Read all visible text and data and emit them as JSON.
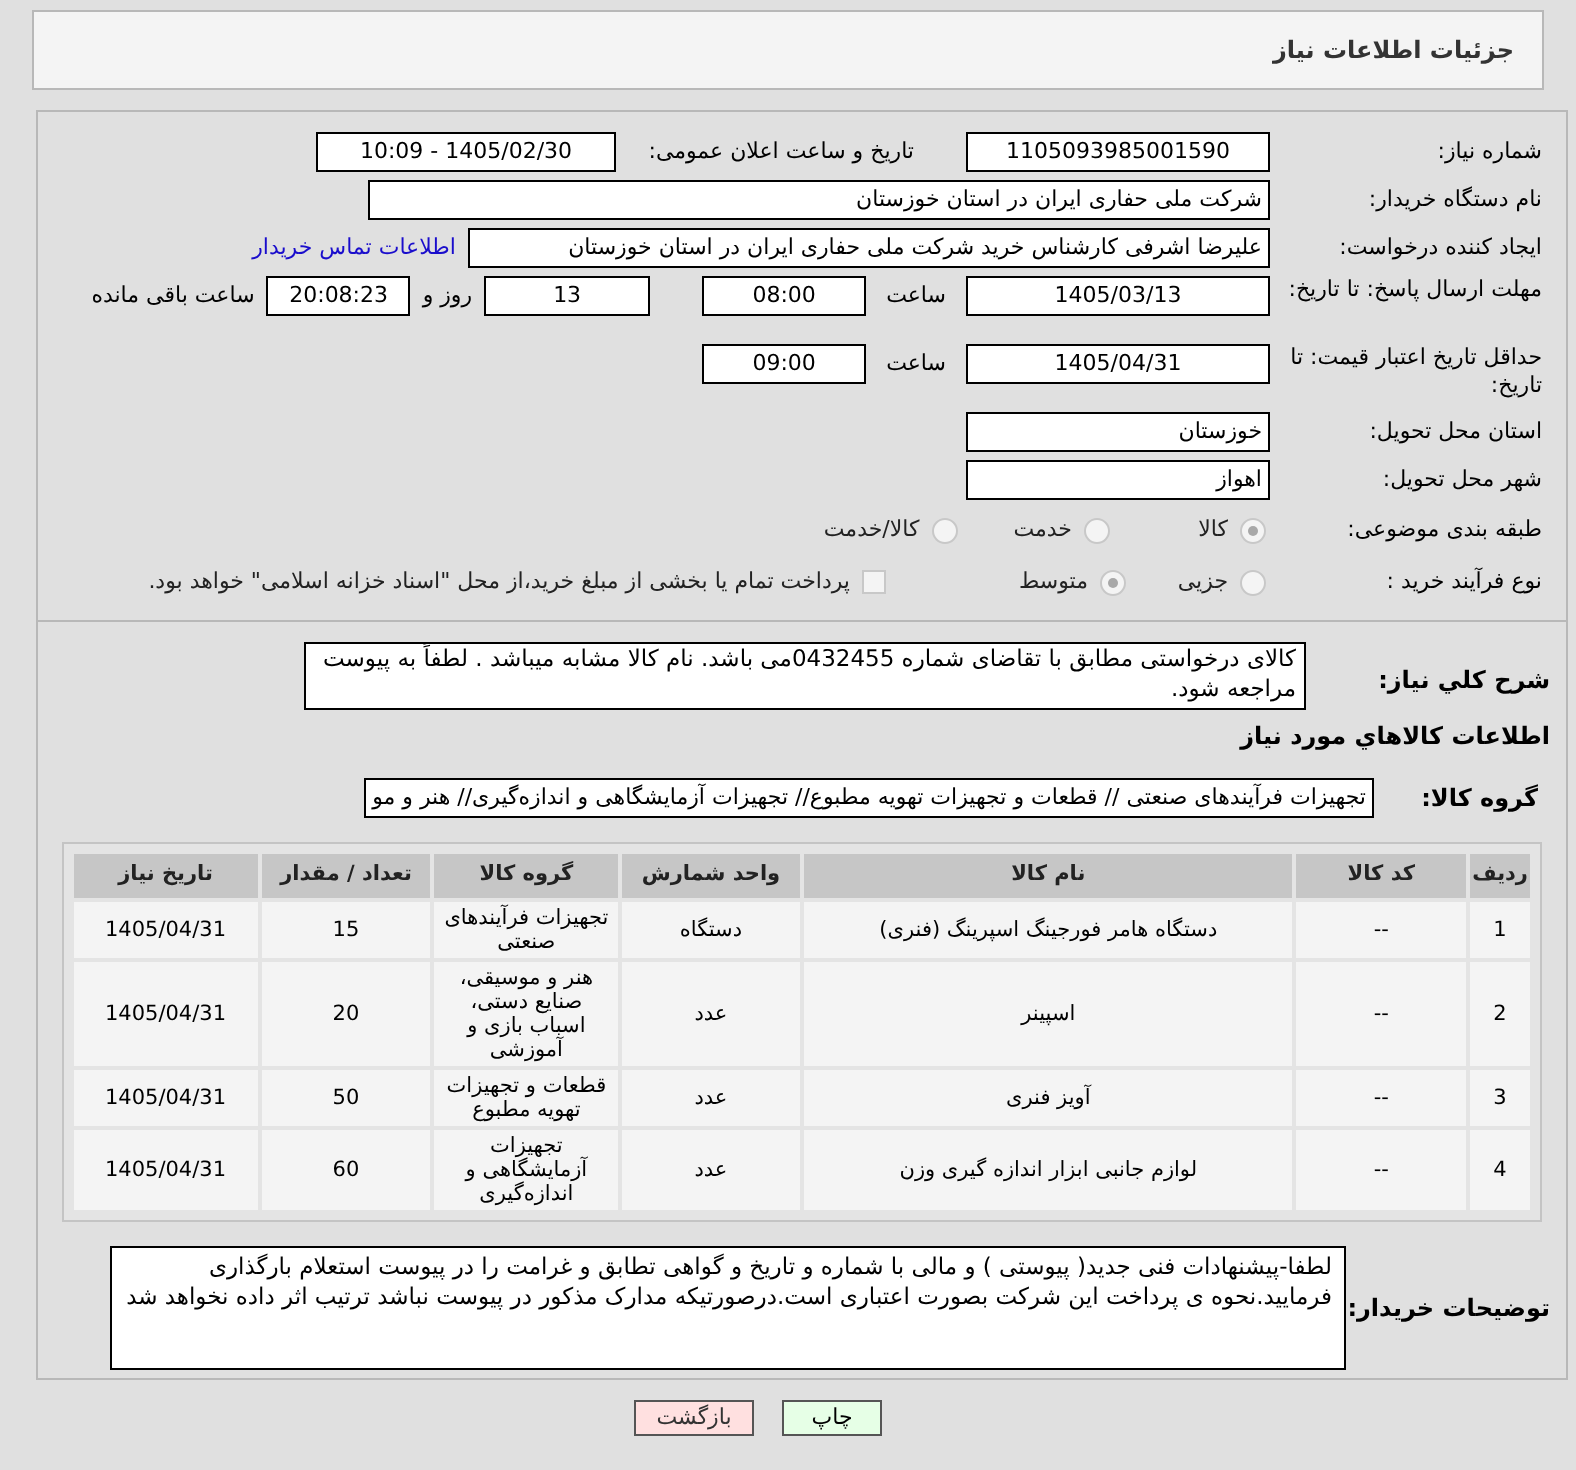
{
  "header": {
    "title": "جزئیات اطلاعات نیاز"
  },
  "need_number": {
    "label": "شماره نیاز:",
    "value": "1105093985001590"
  },
  "announce": {
    "label": "تاریخ و ساعت اعلان عمومی:",
    "value": "1405/02/30 - 10:09"
  },
  "buyer_org": {
    "label": "نام دستگاه خریدار:",
    "value": "شرکت ملی حفاری ایران در استان خوزستان"
  },
  "requester": {
    "label": "ایجاد کننده درخواست:",
    "value": "علیرضا اشرفی کارشناس خرید شرکت ملی حفاری ایران در استان خوزستان",
    "link": "اطلاعات تماس خریدار"
  },
  "deadline": {
    "label": "مهلت ارسال پاسخ: تا تاریخ:",
    "date": "1405/03/13",
    "time_label": "ساعت",
    "time": "08:00",
    "days": "13",
    "days_label": "روز و",
    "remaining": "20:08:23",
    "remaining_label": "ساعت باقی مانده"
  },
  "price_validity": {
    "label": "حداقل تاریخ اعتبار قیمت: تا تاریخ:",
    "date": "1405/04/31",
    "time_label": "ساعت",
    "time": "09:00"
  },
  "province": {
    "label": "استان محل تحویل:",
    "value": "خوزستان"
  },
  "city": {
    "label": "شهر محل تحویل:",
    "value": "اهواز"
  },
  "category": {
    "label": "طبقه بندی موضوعی:",
    "options": [
      {
        "label": "کالا",
        "selected": true
      },
      {
        "label": "خدمت",
        "selected": false
      },
      {
        "label": "کالا/خدمت",
        "selected": false
      }
    ]
  },
  "process": {
    "label": "نوع فرآیند خرید :",
    "options": [
      {
        "label": "جزیی",
        "selected": false
      },
      {
        "label": "متوسط",
        "selected": true
      }
    ],
    "treasury": {
      "label": "پرداخت تمام یا بخشی از مبلغ خرید،از محل \"اسناد خزانه اسلامی\" خواهد بود.",
      "checked": false
    }
  },
  "description": {
    "label": "شرح کلي نياز:",
    "value": "کالای درخواستی مطابق با تقاضای شماره 0432455می باشد. نام کالا مشابه میباشد . لطفاً به پیوست مراجعه شود."
  },
  "goods_section": {
    "title": "اطلاعات کالاهاي مورد نياز"
  },
  "goods_group": {
    "label": "گروه کالا:",
    "value": "تجهیزات فرآیندهای صنعتی //  قطعات و تجهیزات تهویه مطبوع// تجهیزات آزمایشگاهی و اندازه‌گیری// هنر و مو"
  },
  "table": {
    "columns": [
      "ردیف",
      "کد کالا",
      "نام کالا",
      "واحد شمارش",
      "گروه کالا",
      "تعداد / مقدار",
      "تاریخ نیاز"
    ],
    "rows": [
      [
        "1",
        "--",
        "دستگاه هامر فورجینگ اسپرینگ (فنری)",
        "دستگاه",
        "تجهیزات فرآیندهای صنعتی",
        "15",
        "1405/04/31"
      ],
      [
        "2",
        "--",
        "اسپینر",
        "عدد",
        "هنر و موسیقی، صنایع دستی، اسباب بازی و آموزشی",
        "20",
        "1405/04/31"
      ],
      [
        "3",
        "--",
        "آویز فنری",
        "عدد",
        "قطعات و تجهیزات تهویه مطبوع",
        "50",
        "1405/04/31"
      ],
      [
        "4",
        "--",
        "لوازم جانبی ابزار اندازه گیری وزن",
        "عدد",
        "تجهیزات آزمایشگاهی و اندازه‌گیری",
        "60",
        "1405/04/31"
      ]
    ]
  },
  "buyer_notes": {
    "label": "توضیحات خریدار:",
    "value": "لطفا-پیشنهادات فنی جدید( پیوستی ) و مالی با شماره و تاریخ و گواهی تطابق و غرامت را در پیوست استعلام بارگذاری فرمایید.نحوه ی پرداخت این شرکت بصورت اعتباری است.درصورتیکه مدارک مذکور در پیوست نباشد ترتیب اثر داده نخواهد شد"
  },
  "buttons": [
    {
      "label": "چاپ",
      "kind": "print"
    },
    {
      "label": "بازگشت",
      "kind": "back"
    }
  ]
}
